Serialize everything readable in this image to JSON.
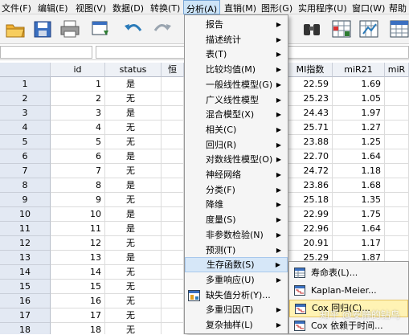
{
  "menubar": {
    "items": [
      "文件(F)",
      "编辑(E)",
      "视图(V)",
      "数据(D)",
      "转换(T)",
      "分析(A)",
      "直销(M)",
      "图形(G)",
      "实用程序(U)",
      "窗口(W)",
      "帮助"
    ]
  },
  "toolbar": {
    "icons": [
      "open-folder-icon",
      "save-icon",
      "print-icon",
      "dialog-recall-icon",
      "undo-icon",
      "redo-icon",
      "find-binoculars-icon",
      "insert-cases-icon",
      "insert-variable-icon",
      "split-file-icon"
    ]
  },
  "grid": {
    "columns": [
      "id",
      "status",
      "恒",
      "MI指数",
      "miR21",
      "miR"
    ],
    "rows": [
      {
        "n": "1",
        "id": "1",
        "status": "是",
        "mi": "22.59",
        "mir21": "1.69"
      },
      {
        "n": "2",
        "id": "2",
        "status": "无",
        "mi": "25.23",
        "mir21": "1.05"
      },
      {
        "n": "3",
        "id": "3",
        "status": "是",
        "mi": "24.43",
        "mir21": "1.97"
      },
      {
        "n": "4",
        "id": "4",
        "status": "无",
        "mi": "25.71",
        "mir21": "1.27"
      },
      {
        "n": "5",
        "id": "5",
        "status": "无",
        "mi": "23.88",
        "mir21": "1.25"
      },
      {
        "n": "6",
        "id": "6",
        "status": "是",
        "mi": "22.70",
        "mir21": "1.64"
      },
      {
        "n": "7",
        "id": "7",
        "status": "无",
        "mi": "24.72",
        "mir21": "1.18"
      },
      {
        "n": "8",
        "id": "8",
        "status": "是",
        "mi": "23.86",
        "mir21": "1.68"
      },
      {
        "n": "9",
        "id": "9",
        "status": "无",
        "mi": "25.18",
        "mir21": "1.35"
      },
      {
        "n": "10",
        "id": "10",
        "status": "是",
        "mi": "22.99",
        "mir21": "1.75"
      },
      {
        "n": "11",
        "id": "11",
        "status": "是",
        "mi": "22.96",
        "mir21": "1.64"
      },
      {
        "n": "12",
        "id": "12",
        "status": "无",
        "mi": "20.91",
        "mir21": "1.17"
      },
      {
        "n": "13",
        "id": "13",
        "status": "是",
        "mi": "25.29",
        "mir21": "1.87"
      },
      {
        "n": "14",
        "id": "14",
        "status": "无",
        "mi": "",
        "mir21": ""
      },
      {
        "n": "15",
        "id": "15",
        "status": "无",
        "mi": "",
        "mir21": ""
      },
      {
        "n": "16",
        "id": "16",
        "status": "无",
        "mi": "",
        "mir21": ""
      },
      {
        "n": "17",
        "id": "17",
        "status": "无",
        "mi": "",
        "mir21": ""
      },
      {
        "n": "18",
        "id": "18",
        "status": "无",
        "mi": "",
        "mir21": ""
      }
    ]
  },
  "analyze_menu": {
    "items": [
      {
        "label": "报告",
        "arrow": "▶"
      },
      {
        "label": "描述统计",
        "arrow": "▶"
      },
      {
        "label": "表(T)",
        "arrow": "▶"
      },
      {
        "label": "比较均值(M)",
        "arrow": "▶"
      },
      {
        "label": "一般线性模型(G)",
        "arrow": "▶"
      },
      {
        "label": "广义线性模型",
        "arrow": "▶"
      },
      {
        "label": "混合模型(X)",
        "arrow": "▶"
      },
      {
        "label": "相关(C)",
        "arrow": "▶"
      },
      {
        "label": "回归(R)",
        "arrow": "▶"
      },
      {
        "label": "对数线性模型(O)",
        "arrow": "▶"
      },
      {
        "label": "神经网络",
        "arrow": "▶"
      },
      {
        "label": "分类(F)",
        "arrow": "▶"
      },
      {
        "label": "降维",
        "arrow": "▶"
      },
      {
        "label": "度量(S)",
        "arrow": "▶"
      },
      {
        "label": "非参数检验(N)",
        "arrow": "▶"
      },
      {
        "label": "预测(T)",
        "arrow": "▶"
      },
      {
        "label": "生存函数(S)",
        "arrow": "▶"
      },
      {
        "label": "多重响应(U)",
        "arrow": "▶"
      },
      {
        "label": "缺失值分析(Y)...",
        "arrow": ""
      },
      {
        "label": "多重归因(T)",
        "arrow": "▶"
      },
      {
        "label": "复杂抽样(L)",
        "arrow": "▶"
      }
    ],
    "highlighted_index": 16
  },
  "survival_submenu": {
    "items": [
      {
        "label": "寿命表(L)..."
      },
      {
        "label": "Kaplan-Meier..."
      },
      {
        "label": "Cox 回归(C)..."
      },
      {
        "label": "Cox 依赖于时间..."
      }
    ],
    "highlighted_index": 2
  },
  "watermark": "知乎 @安静的钻鸟",
  "colors": {
    "menu_highlight": "#d6e7f8",
    "submenu_highlight": "#fff3b4",
    "row_header": "#e3e9f3"
  }
}
